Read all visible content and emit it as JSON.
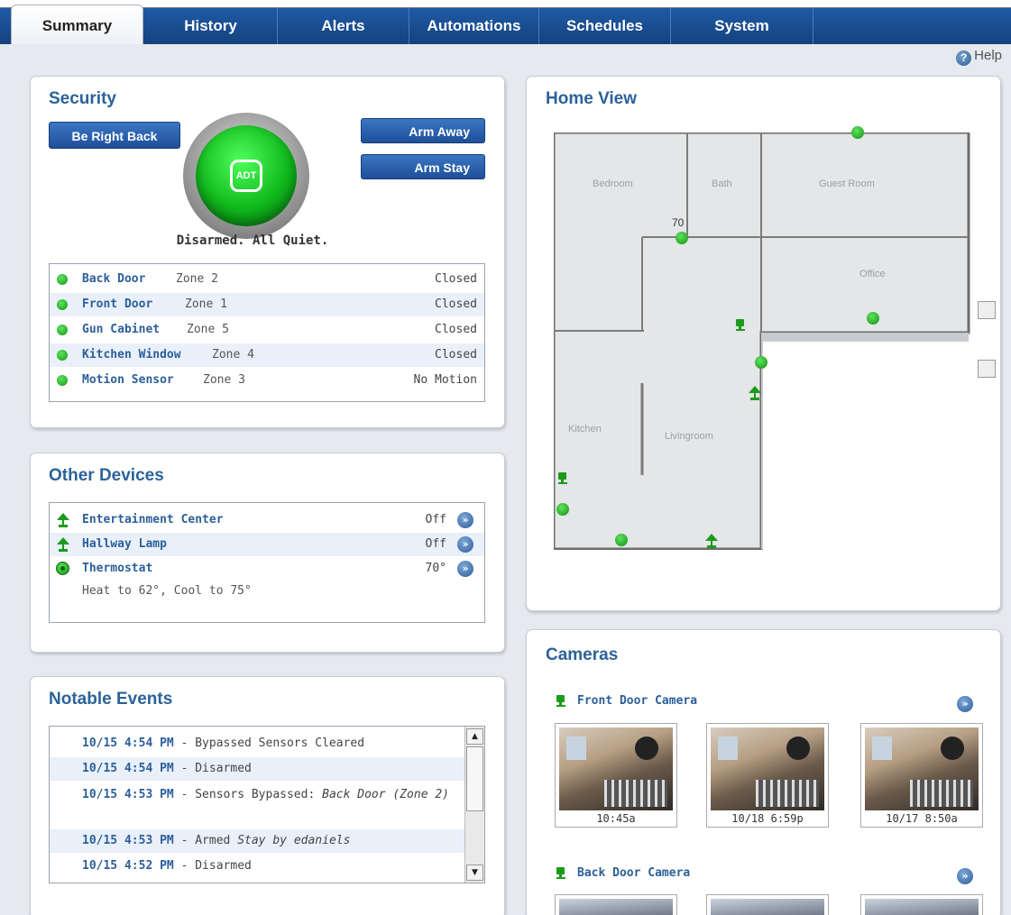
{
  "tabs": [
    {
      "label": "Summary",
      "active": true
    },
    {
      "label": "History"
    },
    {
      "label": "Alerts"
    },
    {
      "label": "Automations"
    },
    {
      "label": "Schedules"
    },
    {
      "label": "System"
    }
  ],
  "help_label": "Help",
  "security": {
    "title": "Security",
    "be_right_back": "Be Right Back",
    "arm_away": "Arm Away",
    "arm_stay": "Arm Stay",
    "logo_text": "ADT",
    "status": "Disarmed. All Quiet.",
    "zones": [
      {
        "name": "Back Door",
        "zone": "Zone 2",
        "state": "Closed"
      },
      {
        "name": "Front Door",
        "zone": "Zone 1",
        "state": "Closed"
      },
      {
        "name": "Gun Cabinet",
        "zone": "Zone 5",
        "state": "Closed"
      },
      {
        "name": "Kitchen Window",
        "zone": "Zone 4",
        "state": "Closed"
      },
      {
        "name": "Motion Sensor",
        "zone": "Zone 3",
        "state": "No Motion"
      }
    ]
  },
  "other_devices": {
    "title": "Other Devices",
    "devices": [
      {
        "name": "Entertainment Center",
        "state": "Off",
        "icon": "lamp-icon"
      },
      {
        "name": "Hallway Lamp",
        "state": "Off",
        "icon": "lamp-icon"
      },
      {
        "name": "Thermostat",
        "state": "70°",
        "icon": "thermostat-icon"
      }
    ],
    "thermostat_detail": "Heat to 62°, Cool to 75°"
  },
  "events": {
    "title": "Notable Events",
    "items": [
      {
        "time": "10/15 4:54 PM",
        "text": " - Bypassed Sensors Cleared",
        "italic": ""
      },
      {
        "time": "10/15 4:54 PM",
        "text": " - Disarmed",
        "italic": ""
      },
      {
        "time": "10/15 4:53 PM",
        "text": " - Sensors Bypassed: ",
        "italic": "Back Door (Zone 2)"
      },
      {
        "time": "10/15 4:53 PM",
        "text": " - Armed ",
        "italic": "Stay by edaniels"
      },
      {
        "time": "10/15 4:52 PM",
        "text": " - Disarmed",
        "italic": ""
      }
    ]
  },
  "home_view": {
    "title": "Home View",
    "rooms": [
      "Bedroom",
      "Bath",
      "Guest Room",
      "Office",
      "Kitchen",
      "Livingroom"
    ],
    "thermostat_reading": "70"
  },
  "cameras": {
    "title": "Cameras",
    "front": {
      "name": "Front Door Camera",
      "thumbs": [
        "10:45a",
        "10/18 6:59p",
        "10/17 8:50a"
      ]
    },
    "back": {
      "name": "Back Door Camera"
    }
  },
  "colors": {
    "accent": "#2c6299",
    "tabbar": "#1f5aa6",
    "status_green": "#139413"
  }
}
